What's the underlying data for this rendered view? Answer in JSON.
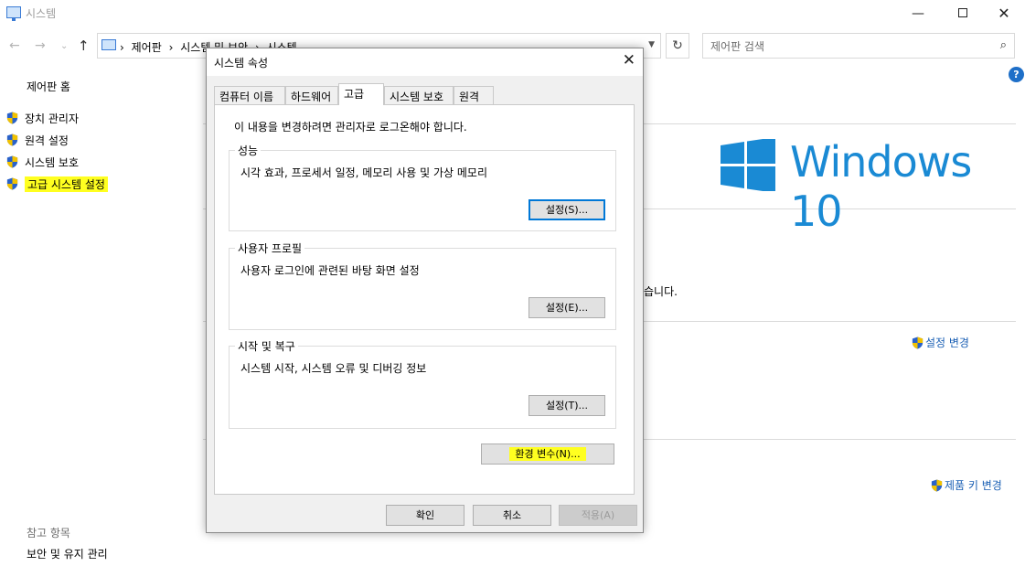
{
  "window": {
    "title": "시스템",
    "minimize": "—",
    "close": "✕"
  },
  "nav": {
    "back": "←",
    "forward": "→",
    "recent": "⌄",
    "up": "↑",
    "breadcrumbs": [
      "제어판",
      "시스템 및 보안",
      "시스템"
    ],
    "separator": "›",
    "refresh": "↻",
    "search_placeholder": "제어판 검색",
    "search_glyph": "⌕"
  },
  "help": "?",
  "sidebar": {
    "home": "제어판 홈",
    "links": [
      "장치 관리자",
      "원격 설정",
      "시스템 보호",
      "고급 시스템 설정"
    ],
    "see_also_heading": "참고 항목",
    "see_also_link": "보안 및 유지 관리"
  },
  "background": {
    "logo_text": "Windows 10",
    "partial_text": "습니다.",
    "settings_change": "설정 변경",
    "product_key_change": "제품 키 변경"
  },
  "dialog": {
    "title": "시스템 속성",
    "close": "✕",
    "tabs": [
      "컴퓨터 이름",
      "하드웨어",
      "고급",
      "시스템 보호",
      "원격"
    ],
    "active_tab": "고급",
    "admin_note": "이 내용을 변경하려면 관리자로 로그온해야 합니다.",
    "groups": {
      "performance": {
        "title": "성능",
        "desc": "시각 효과, 프로세서 일정, 메모리 사용 및 가상 메모리",
        "button": "설정(S)..."
      },
      "profiles": {
        "title": "사용자 프로필",
        "desc": "사용자 로그인에 관련된 바탕 화면 설정",
        "button": "설정(E)..."
      },
      "startup": {
        "title": "시작 및 복구",
        "desc": "시스템 시작, 시스템 오류 및 디버깅 정보",
        "button": "설정(T)..."
      }
    },
    "env_button": "환경 변수(N)...",
    "ok": "확인",
    "cancel": "취소",
    "apply": "적용(A)"
  },
  "colors": {
    "highlight": "#ffff20",
    "link": "#1a5fb4",
    "windows_blue": "#1a8ad4",
    "focus": "#0078d7"
  }
}
